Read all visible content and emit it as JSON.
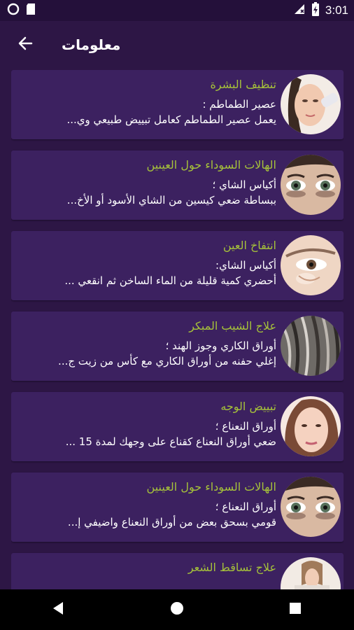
{
  "status_bar": {
    "time": "3:01",
    "icons": [
      "circle-icon",
      "sd-card-icon",
      "no-signal-icon",
      "battery-charging-icon"
    ]
  },
  "app_bar": {
    "title": "معلومات",
    "back_icon": "arrow-back-icon"
  },
  "items": [
    {
      "title": "تنظيف البشرة",
      "subtitle": "عصير الطماطم :",
      "body": "يعمل عصير الطماطم كعامل تبييض طبيعي وي...",
      "image": "face-cleansing"
    },
    {
      "title": "الهالات السوداء حول العينين",
      "subtitle": "أكياس الشاي ؛",
      "body": "ببساطة ضعي كيسين من الشاي الأسود أو الأخ...",
      "image": "dark-circles-eye"
    },
    {
      "title": "انتفاخ العين",
      "subtitle": "أكياس الشاي:",
      "body": "أحضري كمية قليلة من الماء الساخن ثم انقعي ...",
      "image": "eye-puffiness"
    },
    {
      "title": "علاج الشيب المبكر",
      "subtitle": "أوراق الكاري وجوز الهند ؛",
      "body": "إغلي حفنه من أوراق الكاري مع كأس من زيت ج...",
      "image": "gray-hair"
    },
    {
      "title": "تبييض الوجه",
      "subtitle": "أوراق النعناع ؛",
      "body": "ضعي أوراق النعناع كقناع على وجهك لمدة 15 ...",
      "image": "face-whitening"
    },
    {
      "title": "الهالات السوداء حول العينين",
      "subtitle": "أوراق النعناع ؛",
      "body": "قومي بسحق بعض من أوراق النعناع واضيفي إ...",
      "image": "dark-circles-eye"
    },
    {
      "title": "علاج تساقط الشعر",
      "subtitle": "",
      "body": "",
      "image": "hair-loss"
    }
  ],
  "nav_bar": {
    "back": "nav-back-icon",
    "home": "nav-home-icon",
    "recents": "nav-recents-icon"
  },
  "colors": {
    "background": "#2d1645",
    "card": "#3c2160",
    "title_accent": "#a6c23a",
    "text": "#ffffff"
  }
}
